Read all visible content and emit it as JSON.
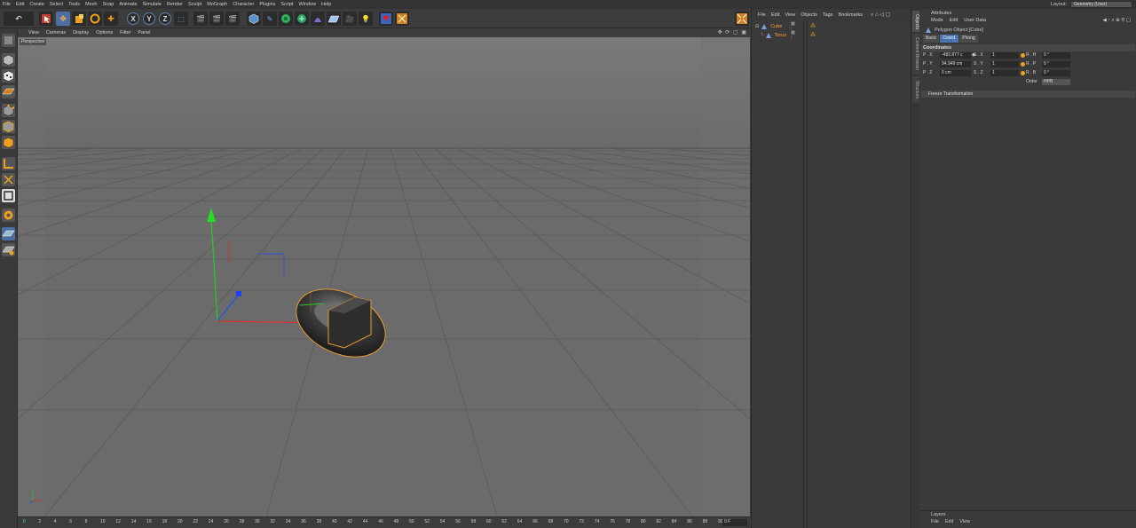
{
  "menu": [
    "File",
    "Edit",
    "Create",
    "Select",
    "Tools",
    "Mesh",
    "Snap",
    "Animate",
    "Simulate",
    "Render",
    "Sculpt",
    "MoGraph",
    "Character",
    "Plugins",
    "Script",
    "Window",
    "Help"
  ],
  "layout": {
    "label": "Layout:",
    "value": "Geometry (User)"
  },
  "toolbar": {
    "axis_x": "X",
    "axis_y": "Y",
    "axis_z": "Z"
  },
  "viewport": {
    "menu": [
      "View",
      "Cameras",
      "Display",
      "Options",
      "Filter",
      "Panel"
    ],
    "camera_label": "Perspective",
    "controls": "✥ ⟳ ▢ ▣"
  },
  "timeline": {
    "ticks": [
      "0",
      "2",
      "4",
      "6",
      "8",
      "10",
      "12",
      "14",
      "16",
      "18",
      "20",
      "22",
      "24",
      "26",
      "28",
      "30",
      "32",
      "34",
      "36",
      "38",
      "40",
      "42",
      "44",
      "46",
      "48",
      "50",
      "52",
      "54",
      "56",
      "58",
      "60",
      "62",
      "64",
      "66",
      "68",
      "70",
      "72",
      "74",
      "76",
      "78",
      "80",
      "82",
      "84",
      "86",
      "88",
      "90"
    ],
    "frame": "0 F"
  },
  "objects": {
    "menu": [
      "File",
      "Edit",
      "View",
      "Objects",
      "Tags",
      "Bookmarks"
    ],
    "items": [
      {
        "name": "Cube",
        "active": true
      },
      {
        "name": "Torus",
        "active": false
      }
    ]
  },
  "side_tabs": [
    "Objects",
    "Content Browser",
    "Structure"
  ],
  "attributes": {
    "title": "Attributes",
    "menu": [
      "Mode",
      "Edit",
      "User Data"
    ],
    "object_title": "Polygon Object [Cube]",
    "tabs": [
      "Basic",
      "Coord.",
      "Phong"
    ],
    "active_tab": "Coord.",
    "section": "Coordinates",
    "rows": [
      {
        "p_label": "P . X",
        "p_value": "-482.877 c",
        "s_label": "S . X",
        "s_value": "1",
        "r_label": "R . H",
        "r_value": "0 °"
      },
      {
        "p_label": "P . Y",
        "p_value": "94.949 cm",
        "s_label": "S . Y",
        "s_value": "1",
        "r_label": "R . P",
        "r_value": "0 °"
      },
      {
        "p_label": "P . Z",
        "p_value": "0 cm",
        "s_label": "S . Z",
        "s_value": "1",
        "r_label": "R . B",
        "r_value": "0 °"
      }
    ],
    "order_label": "Order",
    "order_value": "HPB",
    "freeze": "Freeze Transformation"
  },
  "layers": {
    "title": "Layers",
    "menu": [
      "File",
      "Edit",
      "View"
    ]
  },
  "colors": {
    "accent": "#4a73b0",
    "selection": "#ffa533",
    "axis_x": "#e02020",
    "axis_y": "#20c020",
    "axis_z": "#2040e0"
  }
}
